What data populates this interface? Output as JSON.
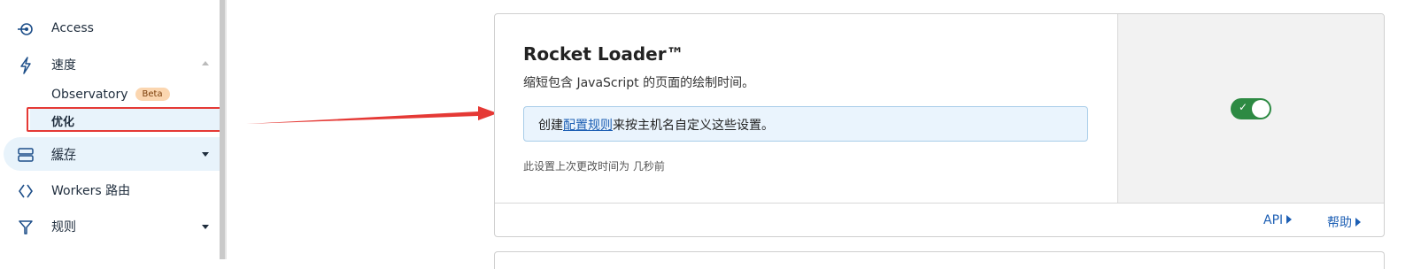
{
  "sidebar": {
    "items": [
      {
        "label": "Access",
        "icon": "access-icon"
      },
      {
        "label": "速度",
        "icon": "lightning-icon"
      },
      {
        "label": "缓存",
        "icon": "cache-icon"
      },
      {
        "label": "Workers 路由",
        "icon": "workers-icon"
      },
      {
        "label": "规则",
        "icon": "rules-icon"
      }
    ],
    "sub_items": [
      {
        "label": "Observatory",
        "badge": "Beta"
      },
      {
        "label": "优化"
      }
    ]
  },
  "card": {
    "title": "Rocket Loader™",
    "description": "缩短包含 JavaScript 的页面的绘制时间。",
    "info_prefix": "创建",
    "info_link": "配置规则",
    "info_suffix": "来按主机名自定义这些设置。",
    "changed_text": "此设置上次更改时间为 几秒前",
    "toggle_on": true,
    "footer_links": [
      "API",
      "帮助"
    ]
  },
  "colors": {
    "accent": "#1d5fb4",
    "toggle_on": "#2d8a43",
    "highlight": "#e53935",
    "badge": "#fbd6b0"
  }
}
